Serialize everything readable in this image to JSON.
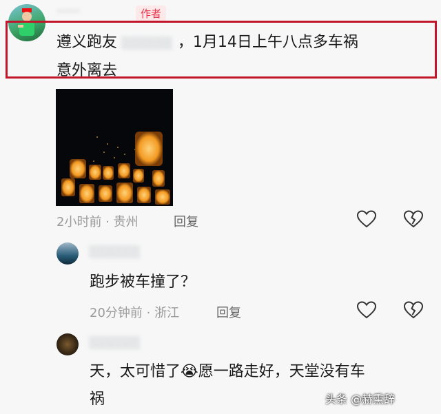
{
  "author_comment": {
    "username": "······",
    "badge": "作者",
    "text_prefix": "遵义跑友",
    "redacted_name": "░░░░░░",
    "text_suffix": "，1月14日上午八点多车祸",
    "text_line2": "意外离去",
    "meta": "2小时前 · 贵州",
    "reply_label": "回复",
    "highlight_color": "#c0152a"
  },
  "comments": [
    {
      "username": "░░░░░░",
      "text": "跑步被车撞了？",
      "meta": "20分钟前 · 浙江",
      "reply_label": "回复"
    },
    {
      "username": "░░░░░░",
      "text_part1": "天，太可惜了",
      "emoji": "😭",
      "text_part2": "愿一路走好，天堂没有车",
      "text_line2": "祸"
    }
  ],
  "watermark": "头条 @赫熏辞",
  "icons": [
    "like-heart-icon",
    "dislike-broken-heart-icon"
  ]
}
